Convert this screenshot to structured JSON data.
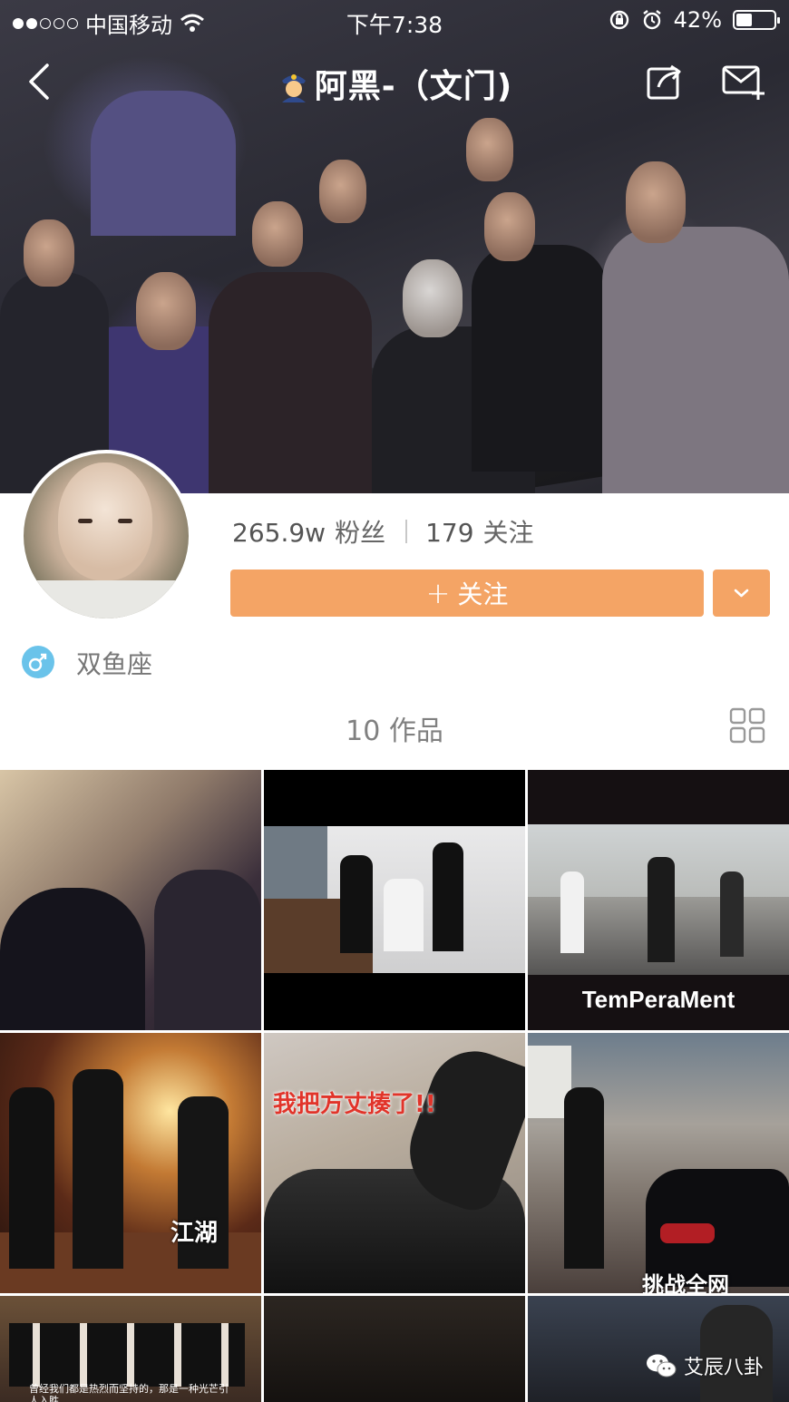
{
  "status_bar": {
    "carrier": "中国移动",
    "time": "下午7:38",
    "battery": "42%",
    "battery_level": 0.42,
    "signal_bars": 2
  },
  "nav": {
    "title": "阿黑-（文门)",
    "title_emoji": "police-officer-emoji"
  },
  "profile": {
    "fans_count": "265.9w",
    "fans_label": "粉丝",
    "following_count": "179",
    "following_label": "关注",
    "follow_button": "关注",
    "follow_plus": "+",
    "gender": "male",
    "sign": "双鱼座"
  },
  "works": {
    "count_label": "10 作品",
    "tiles": [
      {
        "caption": ""
      },
      {
        "caption": ""
      },
      {
        "caption": "TemPeraMent"
      },
      {
        "caption": "江湖"
      },
      {
        "caption": "我把方丈揍了!!"
      },
      {
        "caption": "挑战全网"
      },
      {
        "caption": "曾经我们都是热烈而坚持的，那是一种光芒引人入胜"
      },
      {
        "caption": ""
      },
      {
        "caption": ""
      }
    ]
  },
  "watermark": {
    "text": "艾辰八卦"
  },
  "colors": {
    "accent": "#f4a465",
    "gender_badge": "#6ac3ea",
    "caption_red": "#e1342a"
  }
}
